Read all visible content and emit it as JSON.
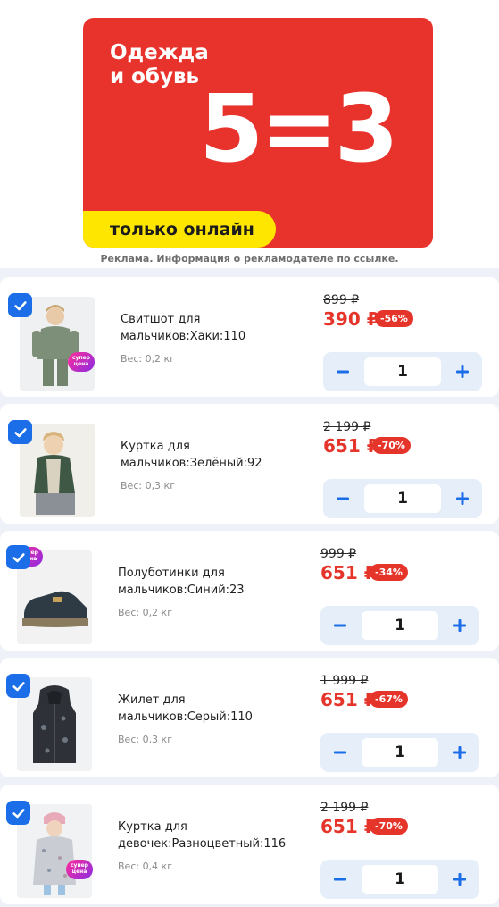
{
  "banner": {
    "title_line1": "Одежда",
    "title_line2": "и обувь",
    "promo": "5=3",
    "strip_text": "только онлайн",
    "note": "Реклама. Информация о рекламодателе по ссылке."
  },
  "colors": {
    "banner_red": "#e8332d",
    "strip_yellow": "#ffe600",
    "accent_blue": "#1b6de8",
    "price_red": "#e5342a"
  },
  "items": [
    {
      "title_line1": "Свитшот для",
      "title_line2": "мальчиков:Хаки:110",
      "weight": "Вес: 0,2 кг",
      "old_price": "899 ₽",
      "new_price": "390 ₽",
      "discount": "-56%",
      "quantity": "1",
      "badge": "супер цена",
      "image_icon": "boy-sweatshirt-khaki-photo"
    },
    {
      "title_line1": "Куртка для",
      "title_line2": "мальчиков:Зелёный:92",
      "weight": "Вес: 0,3 кг",
      "old_price": "2 199 ₽",
      "new_price": "651 ₽",
      "discount": "-70%",
      "quantity": "1",
      "badge": "",
      "image_icon": "boy-jacket-green-photo"
    },
    {
      "title_line1": "Полуботинки для",
      "title_line2": "мальчиков:Синий:23",
      "weight": "Вес: 0,2 кг",
      "old_price": "999 ₽",
      "new_price": "651 ₽",
      "discount": "-34%",
      "quantity": "1",
      "badge": "супер цена",
      "image_icon": "sneaker-navy-photo"
    },
    {
      "title_line1": "Жилет для",
      "title_line2": "мальчиков:Серый:110",
      "weight": "Вес: 0,3 кг",
      "old_price": "1 999 ₽",
      "new_price": "651 ₽",
      "discount": "-67%",
      "quantity": "1",
      "badge": "",
      "image_icon": "vest-grey-photo"
    },
    {
      "title_line1": "Куртка для",
      "title_line2": "девочек:Разноцветный:116",
      "weight": "Вес: 0,4 кг",
      "old_price": "2 199 ₽",
      "new_price": "651 ₽",
      "discount": "-70%",
      "quantity": "1",
      "badge": "супер цена",
      "image_icon": "girl-jacket-multicolor-photo"
    }
  ]
}
